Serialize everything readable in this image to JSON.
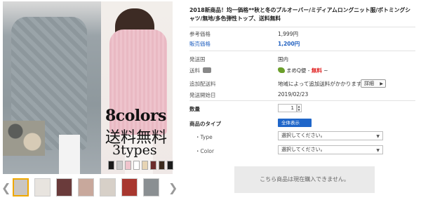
{
  "product": {
    "title": "2018新商品！均一価格**秋と冬のプルオーバー/ミディアムロングニット服/ボトミングシャツ/無地/多色弾性トップ、送料無料",
    "promo": {
      "colors_text": "8colors",
      "shipping_text": "送料無料",
      "types_text": "3types"
    },
    "swatch_colors": [
      "#1a1a1a",
      "#c9c9c9",
      "#f0c4cc",
      "#ffffff",
      "#e7d4b4",
      "#6b2c2c",
      "#3b2a1e",
      "#1c1c1c"
    ],
    "thumbnails": [
      {
        "color": "#c9c5c2",
        "active": true
      },
      {
        "color": "#e8e4df"
      },
      {
        "color": "#6a3b3b"
      },
      {
        "color": "#c8a89c"
      },
      {
        "color": "#d7d0c8"
      },
      {
        "color": "#a8372f"
      },
      {
        "color": "#8a8f92"
      }
    ]
  },
  "pricing": {
    "ref_price_label": "参考価格",
    "ref_price": "1,999円",
    "sale_price_label": "販売価格",
    "sale_price": "1,200円"
  },
  "shipping": {
    "origin_label": "発送国",
    "origin": "国内",
    "fee_label": "送料",
    "carrier": "まめQ便",
    "free_text": "無料",
    "extra_label": "追加配送料",
    "extra_value": "地域によって追加送料がかかります。",
    "detail_button": "詳細",
    "start_label": "発送開始日",
    "start_date": "2019/02/23"
  },
  "order": {
    "qty_label": "数量",
    "qty_value": "1",
    "type_label": "商品のタイプ",
    "show_all_button": "全体表示",
    "option_type_label": "・Type",
    "option_type_value": "選択してください。",
    "option_color_label": "・Color",
    "option_color_value": "選択してください。",
    "unavailable_notice": "こちら商品は現在購入できません。"
  }
}
